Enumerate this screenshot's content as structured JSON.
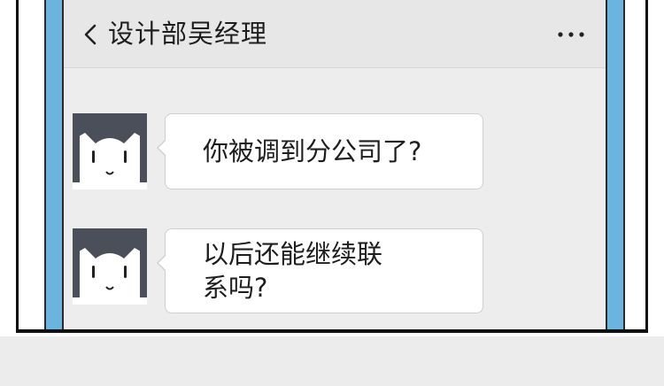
{
  "header": {
    "back_icon": "chevron-left-icon",
    "title": "设计部吴经理",
    "more_icon": "more-dots-icon"
  },
  "messages": [
    {
      "sender": "other",
      "avatar_icon": "cat-avatar-icon",
      "text": "你被调到分公司了?"
    },
    {
      "sender": "other",
      "avatar_icon": "cat-avatar-icon",
      "text": "以后还能继续联系吗?"
    }
  ],
  "colors": {
    "bezel": "#6cb4e0",
    "screen_bg": "#ededed",
    "nav_bg": "#e7e7e7",
    "bubble_bg": "#ffffff",
    "avatar_dark": "#4b4f5a"
  }
}
